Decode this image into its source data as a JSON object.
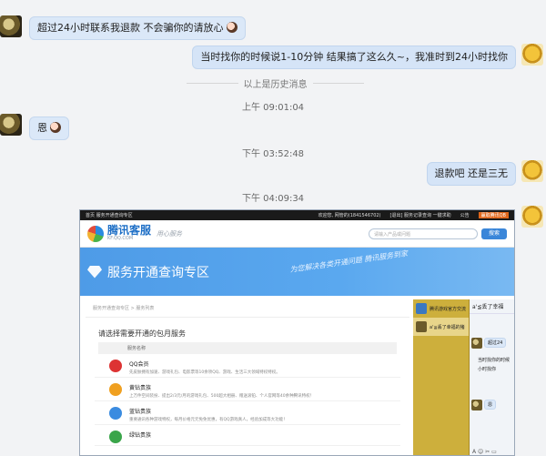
{
  "messages": [
    {
      "side": "left",
      "text": "超过24小时联系我退款 不会骗你的请放心"
    },
    {
      "side": "right",
      "text": "当时找你的时候说1-10分钟 结果搞了这么久~，我准时到24小时找你"
    },
    {
      "side": "left",
      "text": "恩"
    },
    {
      "side": "right",
      "text": "退款吧  还是三无"
    }
  ],
  "history_label": "以上是历史消息",
  "timestamps": [
    "上午 09:01:04",
    "下午 03:52:48",
    "下午 04:09:34"
  ],
  "screenshot": {
    "topbar": {
      "left": "首页  服务开通查询专区",
      "user": "欢迎您, 网管的(1841546702)",
      "links": "[退出]  服务记录查询  一键求助",
      "notice": "公告",
      "button": "赢取腾讯QB"
    },
    "logo": {
      "name": "腾讯客服",
      "url": "KF.QQ.COM",
      "slogan": "用心服务"
    },
    "search": {
      "placeholder": "请输入产品或问题",
      "button": "搜索"
    },
    "banner": {
      "title": "服务开通查询专区",
      "tagline": "为您解决各类开通问题 腾讯服务到家"
    },
    "breadcrumb": "服务开通查询专区  >  服务列表",
    "section_title": "请选择需要开通的包月服务",
    "column_header": "服务名称",
    "services": [
      {
        "name": "QQ会员",
        "desc": "先皮肤拥有加速、游戏礼包、电影票等10余项QQ、游戏、生活三大领域特权特权。",
        "color": "#d33"
      },
      {
        "name": "黄钻贵族",
        "desc": "上万件空间装扮、提出2/3元/月的游戏礼包、500超大相册、赠送滚铂、个人官网等40余种腾讯特权！",
        "color": "#f0a020"
      },
      {
        "name": "蓝钻贵族",
        "desc": "重要通讯各种游戏特权，每月价格元元免免优惠，有QQ游戏真人，经验加成等大功能！",
        "color": "#3a8be0"
      },
      {
        "name": "绿钻贵族",
        "desc": "",
        "color": "#3aa54a"
      }
    ],
    "qq_list": [
      {
        "name": "腾讯游戏官方交流"
      },
      {
        "name": "a'≦丢了幸福的猪"
      }
    ],
    "qq_window": {
      "title": "a'≦丢了幸福",
      "msgs": [
        "超过24",
        "当时找你的时候",
        "小时找你",
        "恩"
      ],
      "footer": "A ☺ ✂ ▭"
    }
  }
}
